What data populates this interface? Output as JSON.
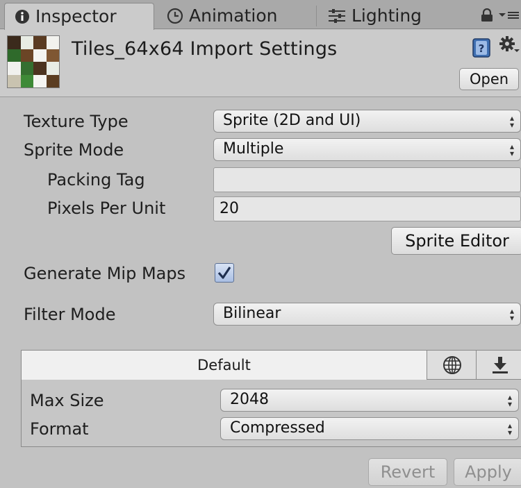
{
  "tabs": [
    {
      "label": "Inspector",
      "icon": "info-icon",
      "active": true
    },
    {
      "label": "Animation",
      "icon": "clock-icon",
      "active": false
    },
    {
      "label": "Lighting",
      "icon": "sliders-icon",
      "active": false
    }
  ],
  "header": {
    "title": "Tiles_64x64 Import Settings",
    "open_label": "Open"
  },
  "form": {
    "texture_type_label": "Texture Type",
    "texture_type_value": "Sprite (2D and UI)",
    "sprite_mode_label": "Sprite Mode",
    "sprite_mode_value": "Multiple",
    "packing_tag_label": "Packing Tag",
    "packing_tag_value": "",
    "pixels_per_unit_label": "Pixels Per Unit",
    "pixels_per_unit_value": "20",
    "sprite_editor_label": "Sprite Editor",
    "generate_mip_maps_label": "Generate Mip Maps",
    "generate_mip_maps_checked": true,
    "filter_mode_label": "Filter Mode",
    "filter_mode_value": "Bilinear"
  },
  "platform": {
    "default_tab_label": "Default",
    "max_size_label": "Max Size",
    "max_size_value": "2048",
    "format_label": "Format",
    "format_value": "Compressed"
  },
  "footer": {
    "revert_label": "Revert",
    "apply_label": "Apply"
  },
  "colors": {
    "panel_bg": "#c2c2c2",
    "tabbar_bg": "#a9a9a9",
    "checkbox_fill": "#aabfe3"
  }
}
